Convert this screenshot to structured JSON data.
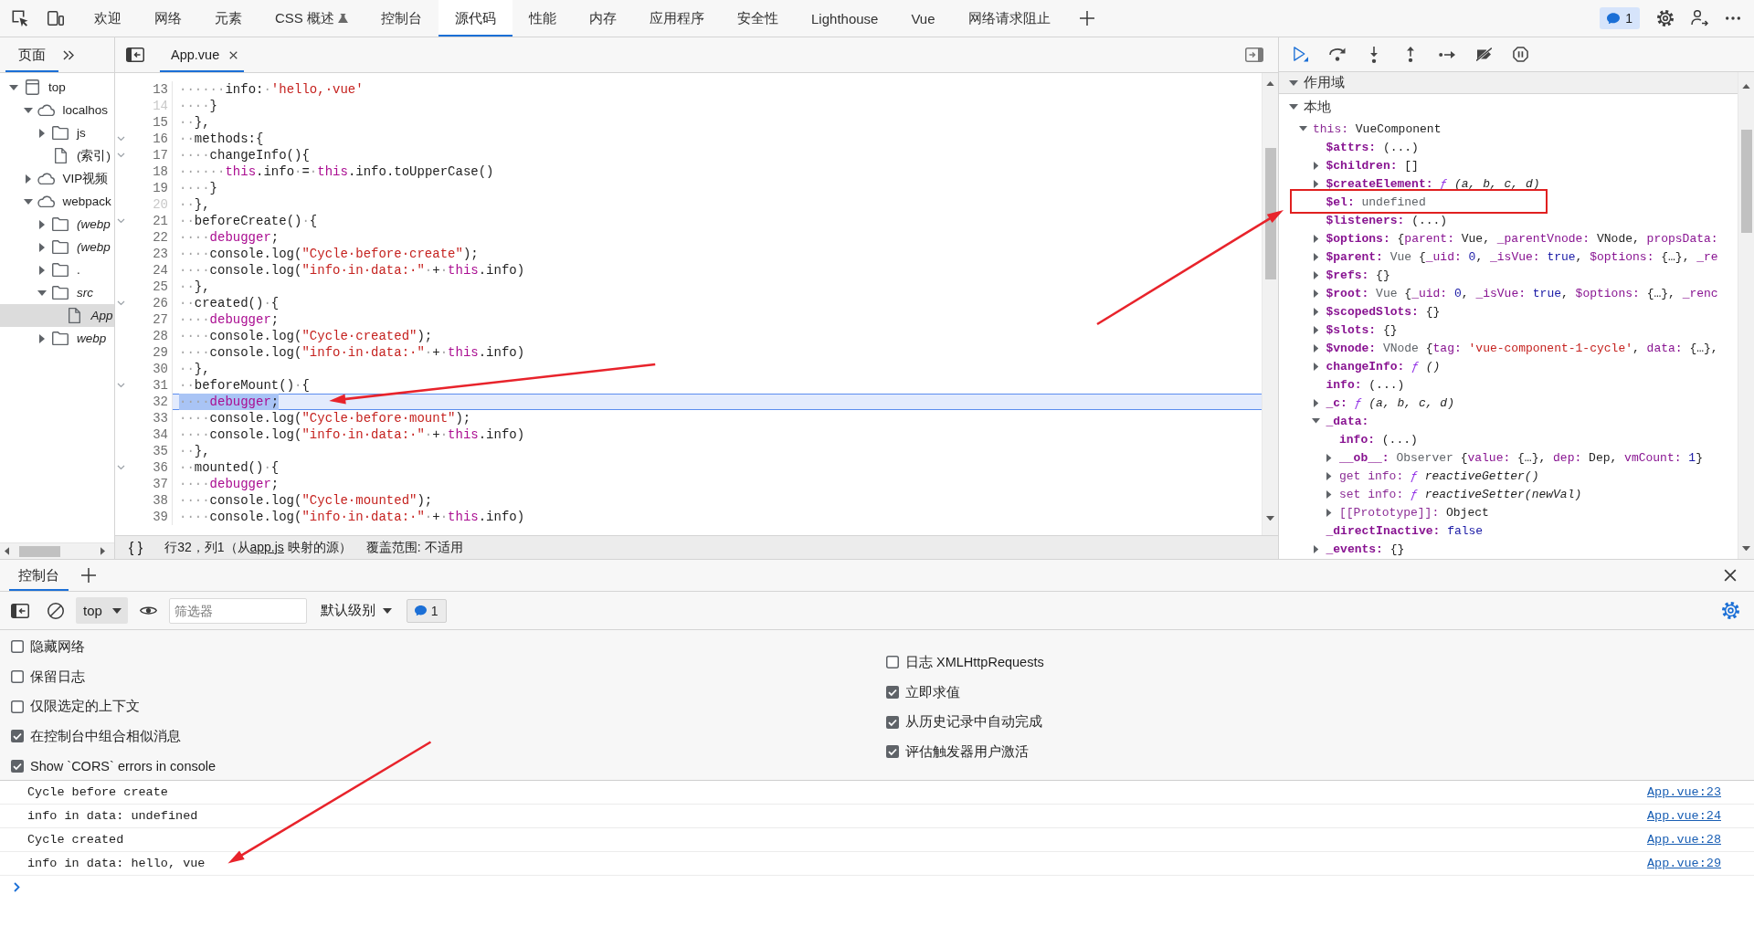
{
  "main_toolbar": {
    "tabs": [
      {
        "label": "欢迎",
        "selected": false,
        "experimental": false
      },
      {
        "label": "网络",
        "selected": false,
        "experimental": false
      },
      {
        "label": "元素",
        "selected": false,
        "experimental": false
      },
      {
        "label": "CSS 概述",
        "selected": false,
        "experimental": true
      },
      {
        "label": "控制台",
        "selected": false,
        "experimental": false
      },
      {
        "label": "源代码",
        "selected": true,
        "experimental": false
      },
      {
        "label": "性能",
        "selected": false,
        "experimental": false
      },
      {
        "label": "内存",
        "selected": false,
        "experimental": false
      },
      {
        "label": "应用程序",
        "selected": false,
        "experimental": false
      },
      {
        "label": "安全性",
        "selected": false,
        "experimental": false
      },
      {
        "label": "Lighthouse",
        "selected": false,
        "experimental": false
      },
      {
        "label": "Vue",
        "selected": false,
        "experimental": false
      },
      {
        "label": "网络请求阻止",
        "selected": false,
        "experimental": false
      }
    ],
    "issues_count": "1"
  },
  "navigator": {
    "tabs": [
      {
        "label": "页面",
        "selected": true
      }
    ],
    "tree": [
      {
        "label": "top",
        "kind": "frame",
        "expanded": true,
        "selected": false,
        "children": [
          {
            "label": "localhos",
            "kind": "origin",
            "expanded": true,
            "selected": false,
            "children": [
              {
                "label": "js",
                "kind": "folder",
                "expanded": false,
                "selected": false
              },
              {
                "label": "(索引)",
                "kind": "file",
                "selected": false
              }
            ]
          },
          {
            "label": "VIP视频",
            "kind": "origin",
            "expanded": false,
            "selected": false
          },
          {
            "label": "webpack",
            "kind": "origin",
            "expanded": true,
            "selected": false,
            "children": [
              {
                "label": "(webp",
                "kind": "mapped_folder",
                "expanded": false,
                "selected": false
              },
              {
                "label": "(webp",
                "kind": "mapped_folder",
                "expanded": false,
                "selected": false
              },
              {
                "label": ".",
                "kind": "folder",
                "expanded": false,
                "selected": false
              },
              {
                "label": "src",
                "kind": "mapped_folder",
                "expanded": true,
                "selected": false,
                "children": [
                  {
                    "label": "App",
                    "kind": "mapped_file",
                    "selected": true
                  }
                ]
              },
              {
                "label": "webp",
                "kind": "mapped_folder",
                "expanded": false,
                "selected": false
              }
            ]
          }
        ]
      }
    ]
  },
  "editor": {
    "tabs": [
      {
        "label": "App.vue",
        "selected": true
      }
    ],
    "lines": [
      {
        "number": "13",
        "foldable": false,
        "dimmed": false,
        "current": false,
        "arrow": false,
        "code": [
          {
            "kind": "space",
            "text": "······"
          },
          {
            "kind": "plain",
            "text": "info:"
          },
          {
            "kind": "space",
            "text": "·"
          },
          {
            "kind": "string",
            "text": "'hello,·vue'"
          }
        ]
      },
      {
        "number": "14",
        "foldable": false,
        "dimmed": true,
        "current": false,
        "arrow": false,
        "code": [
          {
            "kind": "space",
            "text": "····"
          },
          {
            "kind": "plain",
            "text": "}"
          }
        ]
      },
      {
        "number": "15",
        "foldable": false,
        "dimmed": false,
        "current": false,
        "arrow": false,
        "code": [
          {
            "kind": "space",
            "text": "··"
          },
          {
            "kind": "plain",
            "text": "},"
          }
        ]
      },
      {
        "number": "16",
        "foldable": true,
        "dimmed": false,
        "current": false,
        "arrow": false,
        "code": [
          {
            "kind": "space",
            "text": "··"
          },
          {
            "kind": "plain",
            "text": "methods:{"
          }
        ]
      },
      {
        "number": "17",
        "foldable": true,
        "dimmed": false,
        "current": false,
        "arrow": false,
        "code": [
          {
            "kind": "space",
            "text": "····"
          },
          {
            "kind": "plain",
            "text": "changeInfo(){"
          }
        ]
      },
      {
        "number": "18",
        "foldable": false,
        "dimmed": false,
        "current": false,
        "arrow": false,
        "code": [
          {
            "kind": "space",
            "text": "······"
          },
          {
            "kind": "keyword",
            "text": "this"
          },
          {
            "kind": "plain",
            "text": ".info"
          },
          {
            "kind": "space",
            "text": "·"
          },
          {
            "kind": "plain",
            "text": "="
          },
          {
            "kind": "space",
            "text": "·"
          },
          {
            "kind": "keyword",
            "text": "this"
          },
          {
            "kind": "plain",
            "text": ".info.toUpperCase()"
          }
        ]
      },
      {
        "number": "19",
        "foldable": false,
        "dimmed": false,
        "current": false,
        "arrow": false,
        "code": [
          {
            "kind": "space",
            "text": "····"
          },
          {
            "kind": "plain",
            "text": "}"
          }
        ]
      },
      {
        "number": "20",
        "foldable": false,
        "dimmed": true,
        "current": false,
        "arrow": false,
        "code": [
          {
            "kind": "space",
            "text": "··"
          },
          {
            "kind": "plain",
            "text": "},"
          }
        ]
      },
      {
        "number": "21",
        "foldable": true,
        "dimmed": false,
        "current": false,
        "arrow": false,
        "code": [
          {
            "kind": "space",
            "text": "··"
          },
          {
            "kind": "plain",
            "text": "beforeCreate()"
          },
          {
            "kind": "space",
            "text": "·"
          },
          {
            "kind": "plain",
            "text": "{"
          }
        ]
      },
      {
        "number": "22",
        "foldable": false,
        "dimmed": false,
        "current": false,
        "arrow": false,
        "code": [
          {
            "kind": "space",
            "text": "····"
          },
          {
            "kind": "keyword",
            "text": "debugger"
          },
          {
            "kind": "plain",
            "text": ";"
          }
        ]
      },
      {
        "number": "23",
        "foldable": false,
        "dimmed": false,
        "current": false,
        "arrow": false,
        "code": [
          {
            "kind": "space",
            "text": "····"
          },
          {
            "kind": "plain",
            "text": "console.log("
          },
          {
            "kind": "string",
            "text": "\"Cycle·before·create\""
          },
          {
            "kind": "plain",
            "text": ");"
          }
        ]
      },
      {
        "number": "24",
        "foldable": false,
        "dimmed": false,
        "current": false,
        "arrow": false,
        "code": [
          {
            "kind": "space",
            "text": "····"
          },
          {
            "kind": "plain",
            "text": "console.log("
          },
          {
            "kind": "string",
            "text": "\"info·in·data:·\""
          },
          {
            "kind": "space",
            "text": "·"
          },
          {
            "kind": "plain",
            "text": "+"
          },
          {
            "kind": "space",
            "text": "·"
          },
          {
            "kind": "keyword",
            "text": "this"
          },
          {
            "kind": "plain",
            "text": ".info)"
          }
        ]
      },
      {
        "number": "25",
        "foldable": false,
        "dimmed": false,
        "current": false,
        "arrow": false,
        "code": [
          {
            "kind": "space",
            "text": "··"
          },
          {
            "kind": "plain",
            "text": "},"
          }
        ]
      },
      {
        "number": "26",
        "foldable": true,
        "dimmed": false,
        "current": false,
        "arrow": false,
        "code": [
          {
            "kind": "space",
            "text": "··"
          },
          {
            "kind": "plain",
            "text": "created()"
          },
          {
            "kind": "space",
            "text": "·"
          },
          {
            "kind": "plain",
            "text": "{"
          }
        ]
      },
      {
        "number": "27",
        "foldable": false,
        "dimmed": false,
        "current": false,
        "arrow": false,
        "code": [
          {
            "kind": "space",
            "text": "····"
          },
          {
            "kind": "keyword",
            "text": "debugger"
          },
          {
            "kind": "plain",
            "text": ";"
          }
        ]
      },
      {
        "number": "28",
        "foldable": false,
        "dimmed": false,
        "current": false,
        "arrow": false,
        "code": [
          {
            "kind": "space",
            "text": "····"
          },
          {
            "kind": "plain",
            "text": "console.log("
          },
          {
            "kind": "string",
            "text": "\"Cycle·created\""
          },
          {
            "kind": "plain",
            "text": ");"
          }
        ]
      },
      {
        "number": "29",
        "foldable": false,
        "dimmed": false,
        "current": false,
        "arrow": false,
        "code": [
          {
            "kind": "space",
            "text": "····"
          },
          {
            "kind": "plain",
            "text": "console.log("
          },
          {
            "kind": "string",
            "text": "\"info·in·data:·\""
          },
          {
            "kind": "space",
            "text": "·"
          },
          {
            "kind": "plain",
            "text": "+"
          },
          {
            "kind": "space",
            "text": "·"
          },
          {
            "kind": "keyword",
            "text": "this"
          },
          {
            "kind": "plain",
            "text": ".info)"
          }
        ]
      },
      {
        "number": "30",
        "foldable": false,
        "dimmed": false,
        "current": false,
        "arrow": false,
        "code": [
          {
            "kind": "space",
            "text": "··"
          },
          {
            "kind": "plain",
            "text": "},"
          }
        ]
      },
      {
        "number": "31",
        "foldable": true,
        "dimmed": false,
        "current": false,
        "arrow": false,
        "code": [
          {
            "kind": "space",
            "text": "··"
          },
          {
            "kind": "plain",
            "text": "beforeMount()"
          },
          {
            "kind": "space",
            "text": "·"
          },
          {
            "kind": "plain",
            "text": "{"
          }
        ]
      },
      {
        "number": "32",
        "foldable": false,
        "dimmed": false,
        "current": true,
        "arrow": true,
        "code": [
          {
            "kind": "space",
            "text": "····"
          },
          {
            "kind": "keyword",
            "text": "debugger"
          },
          {
            "kind": "plain",
            "text": ";"
          }
        ]
      },
      {
        "number": "33",
        "foldable": false,
        "dimmed": false,
        "current": false,
        "arrow": false,
        "code": [
          {
            "kind": "space",
            "text": "····"
          },
          {
            "kind": "plain",
            "text": "console.log("
          },
          {
            "kind": "string",
            "text": "\"Cycle·before·mount\""
          },
          {
            "kind": "plain",
            "text": ");"
          }
        ]
      },
      {
        "number": "34",
        "foldable": false,
        "dimmed": false,
        "current": false,
        "arrow": false,
        "code": [
          {
            "kind": "space",
            "text": "····"
          },
          {
            "kind": "plain",
            "text": "console.log("
          },
          {
            "kind": "string",
            "text": "\"info·in·data:·\""
          },
          {
            "kind": "space",
            "text": "·"
          },
          {
            "kind": "plain",
            "text": "+"
          },
          {
            "kind": "space",
            "text": "·"
          },
          {
            "kind": "keyword",
            "text": "this"
          },
          {
            "kind": "plain",
            "text": ".info)"
          }
        ]
      },
      {
        "number": "35",
        "foldable": false,
        "dimmed": false,
        "current": false,
        "arrow": false,
        "code": [
          {
            "kind": "space",
            "text": "··"
          },
          {
            "kind": "plain",
            "text": "},"
          }
        ]
      },
      {
        "number": "36",
        "foldable": true,
        "dimmed": false,
        "current": false,
        "arrow": false,
        "code": [
          {
            "kind": "space",
            "text": "··"
          },
          {
            "kind": "plain",
            "text": "mounted()"
          },
          {
            "kind": "space",
            "text": "·"
          },
          {
            "kind": "plain",
            "text": "{"
          }
        ]
      },
      {
        "number": "37",
        "foldable": false,
        "dimmed": false,
        "current": false,
        "arrow": false,
        "code": [
          {
            "kind": "space",
            "text": "····"
          },
          {
            "kind": "keyword",
            "text": "debugger"
          },
          {
            "kind": "plain",
            "text": ";"
          }
        ]
      },
      {
        "number": "38",
        "foldable": false,
        "dimmed": false,
        "current": false,
        "arrow": false,
        "code": [
          {
            "kind": "space",
            "text": "····"
          },
          {
            "kind": "plain",
            "text": "console.log("
          },
          {
            "kind": "string",
            "text": "\"Cycle·mounted\""
          },
          {
            "kind": "plain",
            "text": ");"
          }
        ]
      },
      {
        "number": "39",
        "foldable": false,
        "dimmed": false,
        "current": false,
        "arrow": false,
        "code": [
          {
            "kind": "space",
            "text": "····"
          },
          {
            "kind": "plain",
            "text": "console.log("
          },
          {
            "kind": "string",
            "text": "\"info·in·data:·\""
          },
          {
            "kind": "space",
            "text": "·"
          },
          {
            "kind": "plain",
            "text": "+"
          },
          {
            "kind": "space",
            "text": "·"
          },
          {
            "kind": "keyword",
            "text": "this"
          },
          {
            "kind": "plain",
            "text": ".info)"
          }
        ]
      }
    ],
    "status": {
      "format_label": "{ }",
      "position": "行32，列1",
      "source_open": "（从",
      "source_link": "app.js",
      "source_close": " 映射的源）",
      "coverage": "覆盖范围: 不适用"
    }
  },
  "debugger": {
    "scope": {
      "label": "作用域",
      "expanded": true,
      "groups": [
        {
          "label": "本地",
          "expanded": true,
          "items": [
            {
              "name": "this:",
              "kind": "internal",
              "expanded": true,
              "framed": false,
              "value": [
                {
                  "kind": "plain",
                  "text": "VueComponent"
                }
              ],
              "children": [
                {
                  "name": "$attrs:",
                  "kind": "property",
                  "framed": false,
                  "value": [
                    {
                      "kind": "plain",
                      "text": "(...)"
                    }
                  ]
                },
                {
                  "name": "$children:",
                  "kind": "property",
                  "expanded": false,
                  "framed": false,
                  "value": [
                    {
                      "kind": "plain",
                      "text": "[]"
                    }
                  ]
                },
                {
                  "name": "$createElement:",
                  "kind": "property",
                  "expanded": false,
                  "framed": false,
                  "value": [
                    {
                      "kind": "function",
                      "text": "ƒ"
                    },
                    {
                      "kind": "signature",
                      "text": " (a, b, c, d)"
                    }
                  ]
                },
                {
                  "name": "$el:",
                  "kind": "property",
                  "framed": true,
                  "value": [
                    {
                      "kind": "muted",
                      "text": "undefined"
                    }
                  ]
                },
                {
                  "name": "$listeners:",
                  "kind": "property",
                  "framed": false,
                  "value": [
                    {
                      "kind": "plain",
                      "text": "(...)"
                    }
                  ]
                },
                {
                  "name": "$options:",
                  "kind": "property",
                  "expanded": false,
                  "framed": false,
                  "value": [
                    {
                      "kind": "plain",
                      "text": "{"
                    },
                    {
                      "kind": "key",
                      "text": "parent:"
                    },
                    {
                      "kind": "plain",
                      "text": " Vue, "
                    },
                    {
                      "kind": "key",
                      "text": "_parentVnode:"
                    },
                    {
                      "kind": "plain",
                      "text": " VNode, "
                    },
                    {
                      "kind": "key",
                      "text": "propsData:"
                    }
                  ]
                },
                {
                  "name": "$parent:",
                  "kind": "property",
                  "expanded": false,
                  "framed": false,
                  "value": [
                    {
                      "kind": "muted",
                      "text": "Vue "
                    },
                    {
                      "kind": "plain",
                      "text": "{"
                    },
                    {
                      "kind": "key",
                      "text": "_uid:"
                    },
                    {
                      "kind": "number",
                      "text": " 0"
                    },
                    {
                      "kind": "plain",
                      "text": ", "
                    },
                    {
                      "kind": "key",
                      "text": "_isVue:"
                    },
                    {
                      "kind": "number",
                      "text": " true"
                    },
                    {
                      "kind": "plain",
                      "text": ", "
                    },
                    {
                      "kind": "key",
                      "text": "$options:"
                    },
                    {
                      "kind": "plain",
                      "text": " {…}, "
                    },
                    {
                      "kind": "key",
                      "text": "_re"
                    }
                  ]
                },
                {
                  "name": "$refs:",
                  "kind": "property",
                  "expanded": false,
                  "framed": false,
                  "value": [
                    {
                      "kind": "plain",
                      "text": "{}"
                    }
                  ]
                },
                {
                  "name": "$root:",
                  "kind": "property",
                  "expanded": false,
                  "framed": false,
                  "value": [
                    {
                      "kind": "muted",
                      "text": "Vue "
                    },
                    {
                      "kind": "plain",
                      "text": "{"
                    },
                    {
                      "kind": "key",
                      "text": "_uid:"
                    },
                    {
                      "kind": "number",
                      "text": " 0"
                    },
                    {
                      "kind": "plain",
                      "text": ", "
                    },
                    {
                      "kind": "key",
                      "text": "_isVue:"
                    },
                    {
                      "kind": "number",
                      "text": " true"
                    },
                    {
                      "kind": "plain",
                      "text": ", "
                    },
                    {
                      "kind": "key",
                      "text": "$options:"
                    },
                    {
                      "kind": "plain",
                      "text": " {…}, "
                    },
                    {
                      "kind": "key",
                      "text": "_renc"
                    }
                  ]
                },
                {
                  "name": "$scopedSlots:",
                  "kind": "property",
                  "expanded": false,
                  "framed": false,
                  "value": [
                    {
                      "kind": "plain",
                      "text": "{}"
                    }
                  ]
                },
                {
                  "name": "$slots:",
                  "kind": "property",
                  "expanded": false,
                  "framed": false,
                  "value": [
                    {
                      "kind": "plain",
                      "text": "{}"
                    }
                  ]
                },
                {
                  "name": "$vnode:",
                  "kind": "property",
                  "expanded": false,
                  "framed": false,
                  "value": [
                    {
                      "kind": "muted",
                      "text": "VNode "
                    },
                    {
                      "kind": "plain",
                      "text": "{"
                    },
                    {
                      "kind": "key",
                      "text": "tag:"
                    },
                    {
                      "kind": "string",
                      "text": " 'vue-component-1-cycle'"
                    },
                    {
                      "kind": "plain",
                      "text": ", "
                    },
                    {
                      "kind": "key",
                      "text": "data:"
                    },
                    {
                      "kind": "plain",
                      "text": " {…},"
                    }
                  ]
                },
                {
                  "name": "changeInfo:",
                  "kind": "property",
                  "expanded": false,
                  "framed": false,
                  "value": [
                    {
                      "kind": "function",
                      "text": "ƒ"
                    },
                    {
                      "kind": "signature",
                      "text": " ()"
                    }
                  ]
                },
                {
                  "name": "info:",
                  "kind": "property",
                  "framed": false,
                  "value": [
                    {
                      "kind": "plain",
                      "text": "(...)"
                    }
                  ]
                },
                {
                  "name": "_c:",
                  "kind": "property",
                  "expanded": false,
                  "framed": false,
                  "value": [
                    {
                      "kind": "function",
                      "text": "ƒ"
                    },
                    {
                      "kind": "signature",
                      "text": " (a, b, c, d)"
                    }
                  ]
                },
                {
                  "name": "_data:",
                  "kind": "property",
                  "expanded": true,
                  "framed": false,
                  "children": [
                    {
                      "name": "info:",
                      "kind": "property",
                      "framed": false,
                      "value": [
                        {
                          "kind": "plain",
                          "text": "(...)"
                        }
                      ]
                    },
                    {
                      "name": "__ob__:",
                      "kind": "property",
                      "expanded": false,
                      "framed": false,
                      "value": [
                        {
                          "kind": "muted",
                          "text": "Observer "
                        },
                        {
                          "kind": "plain",
                          "text": "{"
                        },
                        {
                          "kind": "key",
                          "text": "value:"
                        },
                        {
                          "kind": "plain",
                          "text": " {…}, "
                        },
                        {
                          "kind": "key",
                          "text": "dep:"
                        },
                        {
                          "kind": "plain",
                          "text": " Dep, "
                        },
                        {
                          "kind": "key",
                          "text": "vmCount:"
                        },
                        {
                          "kind": "number",
                          "text": " 1"
                        },
                        {
                          "kind": "plain",
                          "text": "}"
                        }
                      ]
                    },
                    {
                      "name": "get info:",
                      "kind": "internal",
                      "expanded": false,
                      "framed": false,
                      "value": [
                        {
                          "kind": "function",
                          "text": "ƒ"
                        },
                        {
                          "kind": "signature",
                          "text": " reactiveGetter()"
                        }
                      ]
                    },
                    {
                      "name": "set info:",
                      "kind": "internal",
                      "expanded": false,
                      "framed": false,
                      "value": [
                        {
                          "kind": "function",
                          "text": "ƒ"
                        },
                        {
                          "kind": "signature",
                          "text": " reactiveSetter(newVal)"
                        }
                      ]
                    },
                    {
                      "name": "[[Prototype]]:",
                      "kind": "internal",
                      "expanded": false,
                      "framed": false,
                      "value": [
                        {
                          "kind": "plain",
                          "text": "Object"
                        }
                      ]
                    }
                  ]
                },
                {
                  "name": "_directInactive:",
                  "kind": "property",
                  "framed": false,
                  "value": [
                    {
                      "kind": "number",
                      "text": "false"
                    }
                  ]
                },
                {
                  "name": "_events:",
                  "kind": "property",
                  "expanded": false,
                  "framed": false,
                  "value": [
                    {
                      "kind": "plain",
                      "text": "{}"
                    }
                  ]
                }
              ]
            }
          ]
        }
      ]
    }
  },
  "drawer": {
    "tabs": [
      {
        "label": "控制台",
        "selected": true
      }
    ],
    "console": {
      "context": "top",
      "filter": {
        "placeholder": "筛选器"
      },
      "log_levels": "默认级别",
      "issues_count": "1",
      "settings_left": [
        {
          "label": "隐藏网络",
          "checked": false
        },
        {
          "label": "保留日志",
          "checked": false
        },
        {
          "label": "仅限选定的上下文",
          "checked": false
        },
        {
          "label": "在控制台中组合相似消息",
          "checked": true
        },
        {
          "label": "Show `CORS` errors in console",
          "checked": true
        }
      ],
      "settings_right": [
        {
          "label": "日志 XMLHttpRequests",
          "checked": false
        },
        {
          "label": "立即求值",
          "checked": true
        },
        {
          "label": "从历史记录中自动完成",
          "checked": true
        },
        {
          "label": "评估触发器用户激活",
          "checked": true
        }
      ],
      "messages": [
        {
          "text": "Cycle before create",
          "source": "App.vue:23",
          "arrow": false
        },
        {
          "text": "info in data: undefined",
          "source": "App.vue:24",
          "arrow": false
        },
        {
          "text": "Cycle created",
          "source": "App.vue:28",
          "arrow": false
        },
        {
          "text": "info in data: hello, vue",
          "source": "App.vue:29",
          "arrow": true
        }
      ]
    }
  }
}
